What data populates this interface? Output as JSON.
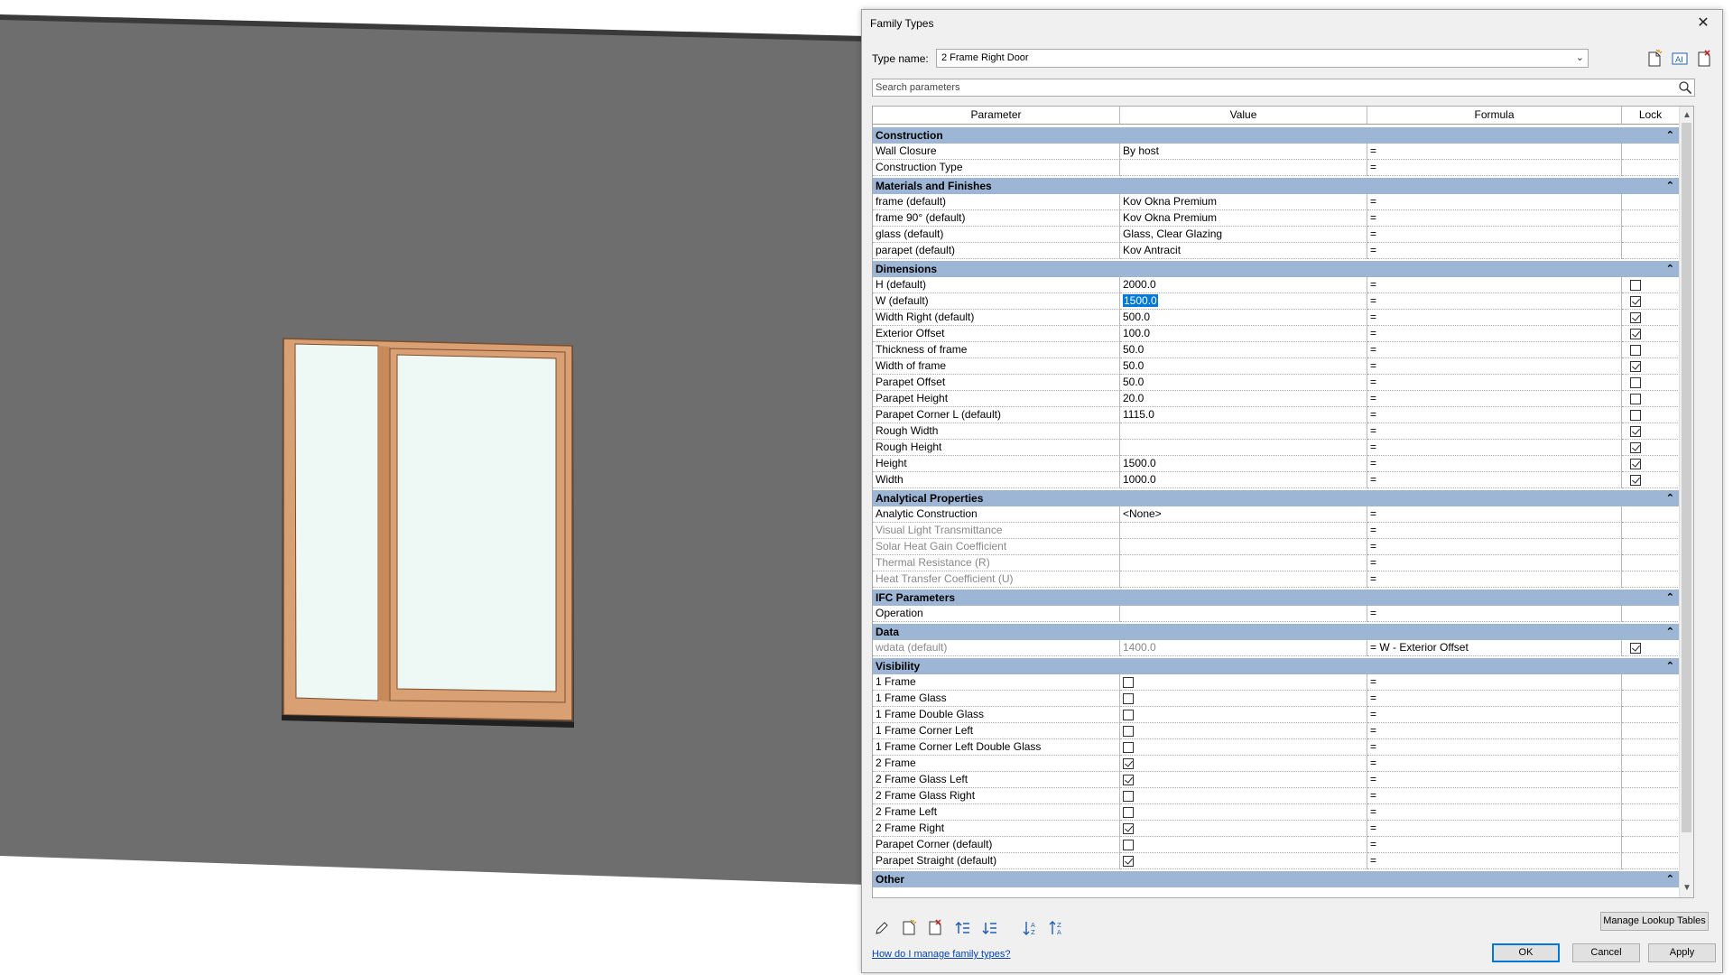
{
  "dialog": {
    "title": "Family Types",
    "close_label": "✕",
    "type_name_label": "Type name:",
    "type_name_value": "2 Frame Right Door",
    "search_placeholder": "Search parameters",
    "headers": [
      "Parameter",
      "Value",
      "Formula",
      "Lock"
    ],
    "manage_lookup_label": "Manage Lookup Tables",
    "help_link": "How do I manage family types?",
    "ok_label": "OK",
    "cancel_label": "Cancel",
    "apply_label": "Apply"
  },
  "sections": [
    {
      "name": "Construction",
      "rows": [
        {
          "param": "Wall Closure",
          "value": "By host",
          "formula": "=",
          "lock": null
        },
        {
          "param": "Construction Type",
          "value": "",
          "formula": "=",
          "lock": null
        }
      ]
    },
    {
      "name": "Materials and Finishes",
      "rows": [
        {
          "param": "frame (default)",
          "value": "Kov Okna Premium",
          "formula": "=",
          "lock": null
        },
        {
          "param": "frame 90° (default)",
          "value": "Kov Okna Premium",
          "formula": "=",
          "lock": null
        },
        {
          "param": "glass (default)",
          "value": "Glass, Clear Glazing",
          "formula": "=",
          "lock": null
        },
        {
          "param": "parapet (default)",
          "value": "Kov Antracit",
          "formula": "=",
          "lock": null
        }
      ]
    },
    {
      "name": "Dimensions",
      "rows": [
        {
          "param": "H (default)",
          "value": "2000.0",
          "formula": "=",
          "lock": false
        },
        {
          "param": "W (default)",
          "value": "1500.0",
          "formula": "=",
          "lock": true,
          "selected": true
        },
        {
          "param": "Width Right (default)",
          "value": "500.0",
          "formula": "=",
          "lock": true
        },
        {
          "param": "Exterior Offset",
          "value": "100.0",
          "formula": "=",
          "lock": true
        },
        {
          "param": "Thickness of frame",
          "value": "50.0",
          "formula": "=",
          "lock": false
        },
        {
          "param": "Width of frame",
          "value": "50.0",
          "formula": "=",
          "lock": true
        },
        {
          "param": "Parapet Offset",
          "value": "50.0",
          "formula": "=",
          "lock": false
        },
        {
          "param": "Parapet Height",
          "value": "20.0",
          "formula": "=",
          "lock": false
        },
        {
          "param": "Parapet Corner L (default)",
          "value": "1115.0",
          "formula": "=",
          "lock": false
        },
        {
          "param": "Rough Width",
          "value": "",
          "formula": "=",
          "lock": true
        },
        {
          "param": "Rough Height",
          "value": "",
          "formula": "=",
          "lock": true
        },
        {
          "param": "Height",
          "value": "1500.0",
          "formula": "=",
          "lock": true
        },
        {
          "param": "Width",
          "value": "1000.0",
          "formula": "=",
          "lock": true
        }
      ]
    },
    {
      "name": "Analytical Properties",
      "rows": [
        {
          "param": "Analytic Construction",
          "value": "<None>",
          "formula": "=",
          "lock": null
        },
        {
          "param": "Visual Light Transmittance",
          "value": "",
          "formula": "=",
          "lock": null,
          "disabled": true
        },
        {
          "param": "Solar Heat Gain Coefficient",
          "value": "",
          "formula": "=",
          "lock": null,
          "disabled": true
        },
        {
          "param": "Thermal Resistance (R)",
          "value": "",
          "formula": "=",
          "lock": null,
          "disabled": true
        },
        {
          "param": "Heat Transfer Coefficient (U)",
          "value": "",
          "formula": "=",
          "lock": null,
          "disabled": true
        }
      ]
    },
    {
      "name": "IFC Parameters",
      "rows": [
        {
          "param": "Operation",
          "value": "",
          "formula": "=",
          "lock": null
        }
      ]
    },
    {
      "name": "Data",
      "rows": [
        {
          "param": "wdata (default)",
          "value": "1400.0",
          "formula": "= W - Exterior Offset",
          "lock": true,
          "disabled": true
        }
      ]
    },
    {
      "name": "Visibility",
      "rows": [
        {
          "param": "1 Frame",
          "checkbox": false,
          "formula": "=",
          "lock": null
        },
        {
          "param": "1 Frame Glass",
          "checkbox": false,
          "formula": "=",
          "lock": null
        },
        {
          "param": "1 Frame Double Glass",
          "checkbox": false,
          "formula": "=",
          "lock": null
        },
        {
          "param": "1 Frame Corner Left",
          "checkbox": false,
          "formula": "=",
          "lock": null
        },
        {
          "param": "1 Frame Corner Left Double Glass",
          "checkbox": false,
          "formula": "=",
          "lock": null
        },
        {
          "param": "2 Frame",
          "checkbox": true,
          "formula": "=",
          "lock": null
        },
        {
          "param": "2 Frame Glass Left",
          "checkbox": true,
          "formula": "=",
          "lock": null
        },
        {
          "param": "2 Frame Glass Right",
          "checkbox": false,
          "formula": "=",
          "lock": null
        },
        {
          "param": "2 Frame Left",
          "checkbox": false,
          "formula": "=",
          "lock": null
        },
        {
          "param": "2 Frame Right",
          "checkbox": true,
          "formula": "=",
          "lock": null
        },
        {
          "param": "Parapet Corner (default)",
          "checkbox": false,
          "formula": "=",
          "lock": null
        },
        {
          "param": "Parapet Straight (default)",
          "checkbox": true,
          "formula": "=",
          "lock": null
        }
      ]
    },
    {
      "name": "Other",
      "rows": []
    }
  ],
  "colors": {
    "section_header": "#9db6d5",
    "wall": "#6e6e6e",
    "frame": "#d9a073",
    "glass": "#eef8f4",
    "selection": "#0078d7"
  }
}
